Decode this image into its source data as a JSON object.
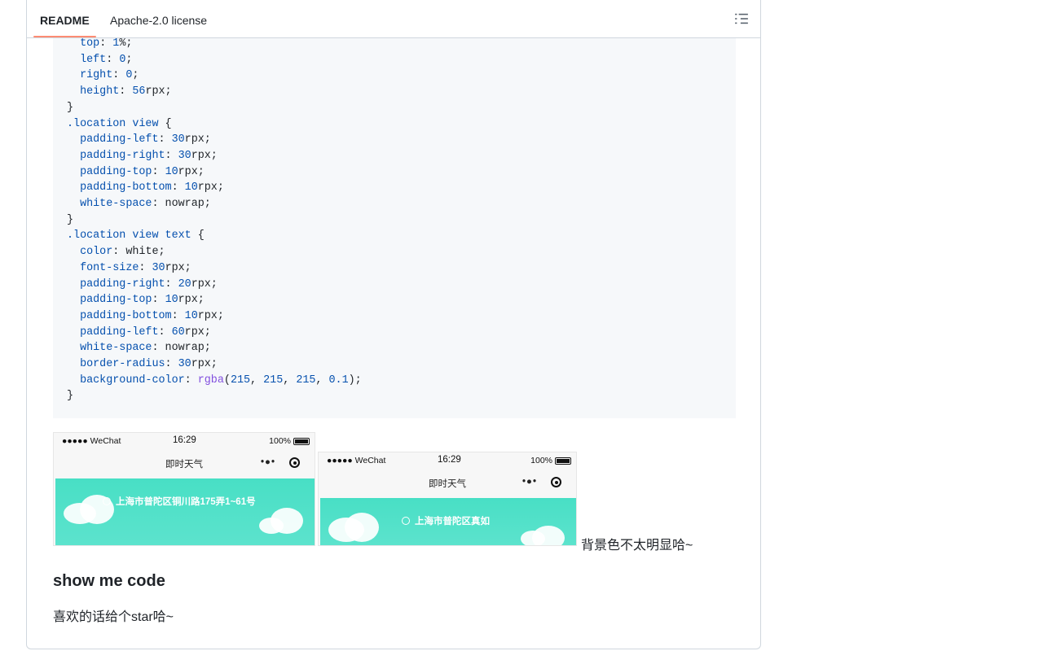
{
  "tabs": {
    "readme": "README",
    "license": "Apache-2.0 license"
  },
  "code_lines": [
    "  <span class=\"prop\">top</span>: <span class=\"num\">1</span>%;",
    "  <span class=\"prop\">left</span>: <span class=\"num\">0</span>;",
    "  <span class=\"prop\">right</span>: <span class=\"num\">0</span>;",
    "  <span class=\"prop\">height</span>: <span class=\"num\">56</span>rpx;",
    "}",
    "<span class=\"sel\">.location view</span> {",
    "  <span class=\"prop\">padding-left</span>: <span class=\"num\">30</span>rpx;",
    "  <span class=\"prop\">padding-right</span>: <span class=\"num\">30</span>rpx;",
    "  <span class=\"prop\">padding-top</span>: <span class=\"num\">10</span>rpx;",
    "  <span class=\"prop\">padding-bottom</span>: <span class=\"num\">10</span>rpx;",
    "  <span class=\"prop\">white-space</span>: nowrap;",
    "}",
    "<span class=\"sel\">.location view text</span> {",
    "  <span class=\"prop\">color</span>: white;",
    "  <span class=\"prop\">font-size</span>: <span class=\"num\">30</span>rpx;",
    "  <span class=\"prop\">padding-right</span>: <span class=\"num\">20</span>rpx;",
    "  <span class=\"prop\">padding-top</span>: <span class=\"num\">10</span>rpx;",
    "  <span class=\"prop\">padding-bottom</span>: <span class=\"num\">10</span>rpx;",
    "  <span class=\"prop\">padding-left</span>: <span class=\"num\">60</span>rpx;",
    "  <span class=\"prop\">white-space</span>: nowrap;",
    "  <span class=\"prop\">border-radius</span>: <span class=\"num\">30</span>rpx;",
    "  <span class=\"prop\">background-color</span>: <span class=\"fn\">rgba</span>(<span class=\"num\">215</span>, <span class=\"num\">215</span>, <span class=\"num\">215</span>, <span class=\"num\">0.1</span>);",
    "}"
  ],
  "screenshot1": {
    "signal": "●●●●● WeChat",
    "time": "16:29",
    "battery": "100%",
    "title": "即时天气",
    "dots": "•●•",
    "location": "上海市普陀区铜川路175弄1~61号"
  },
  "screenshot2": {
    "signal": "●●●●● WeChat",
    "time": "16:29",
    "battery": "100%",
    "title": "即时天气",
    "dots": "•●•",
    "location": "上海市普陀区真如"
  },
  "caption": "背景色不太明显哈~",
  "section_heading": "show me code",
  "section_text": "喜欢的话给个star哈~",
  "colors": {
    "accent_tab_underline": "#fd8c73",
    "code_background": "#f6f8fa",
    "code_property": "#0550ae",
    "code_function": "#8250df",
    "sky": "#48dfc5"
  }
}
